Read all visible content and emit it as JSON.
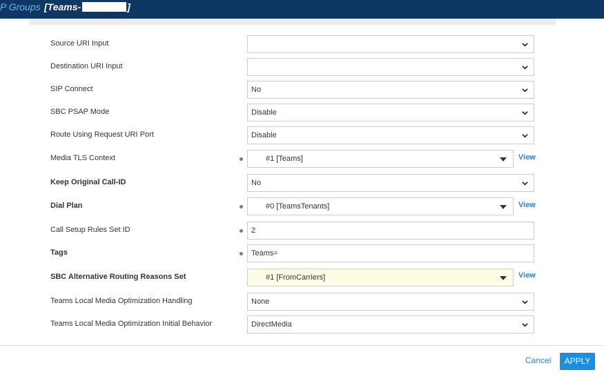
{
  "header": {
    "crumb": "P Groups",
    "title_prefix": "[Teams-",
    "title_suffix": "]"
  },
  "rows": [
    {
      "label": "Source URI Input",
      "value": "",
      "control": "select"
    },
    {
      "label": "Destination URI Input",
      "value": "",
      "control": "select"
    },
    {
      "label": "SIP Connect",
      "value": "No",
      "control": "select"
    },
    {
      "label": "SBC PSAP Mode",
      "value": "Disable",
      "control": "select"
    },
    {
      "label": "Route Using Request URI Port",
      "value": "Disable",
      "control": "select"
    },
    {
      "label": "Media TLS Context",
      "value": "#1 [Teams]",
      "control": "lookup",
      "link": "View"
    },
    {
      "label": "Keep Original Call-ID",
      "value": "No",
      "control": "select"
    },
    {
      "label": "Dial Plan",
      "value": "#0 [TeamsTenants]",
      "control": "lookup",
      "link": "View"
    },
    {
      "label": "Call Setup Rules Set ID",
      "value": "2",
      "control": "text"
    },
    {
      "label": "Tags",
      "value": "Teams=",
      "control": "text"
    },
    {
      "label": "SBC Alternative Routing Reasons Set",
      "value": "#1 [FromCarriers]",
      "control": "lookup",
      "link": "View"
    },
    {
      "label": "Teams Local Media Optimization Handling",
      "value": "None",
      "control": "select"
    },
    {
      "label": "Teams Local Media Optimization Initial Behavior",
      "value": "DirectMedia",
      "control": "select"
    }
  ],
  "footer": {
    "cancel_label": "Cancel",
    "apply_label": "APPLY"
  }
}
